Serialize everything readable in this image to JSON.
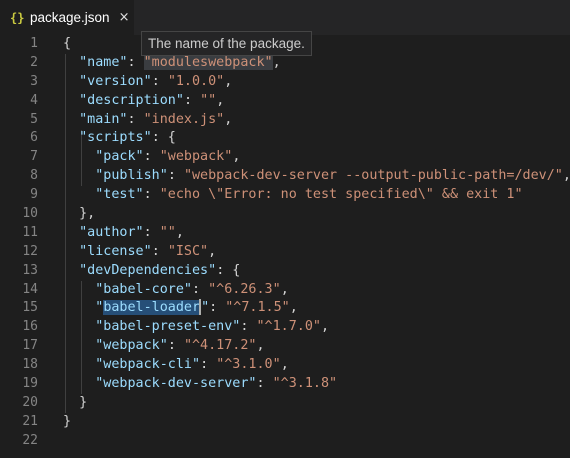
{
  "tab": {
    "icon_text": "{}",
    "title": "package.json",
    "close_glyph": "×"
  },
  "tooltip": {
    "text": "The name of the package."
  },
  "line_numbers": [
    "1",
    "2",
    "3",
    "4",
    "5",
    "6",
    "7",
    "8",
    "9",
    "10",
    "11",
    "12",
    "13",
    "14",
    "15",
    "16",
    "17",
    "18",
    "19",
    "20",
    "21",
    "22"
  ],
  "code": {
    "open_brace": "{",
    "name_key": "\"name\"",
    "name_val": "\"moduleswebpack\"",
    "version_key": "\"version\"",
    "version_val": "\"1.0.0\"",
    "description_key": "\"description\"",
    "description_val": "\"\"",
    "main_key": "\"main\"",
    "main_val": "\"index.js\"",
    "scripts_key": "\"scripts\"",
    "pack_key": "\"pack\"",
    "pack_val": "\"webpack\"",
    "publish_key": "\"publish\"",
    "publish_val": "\"webpack-dev-server --output-public-path=/dev/\"",
    "test_key": "\"test\"",
    "test_val": "\"echo \\\"Error: no test specified\\\" && exit 1\"",
    "author_key": "\"author\"",
    "author_val": "\"\"",
    "license_key": "\"license\"",
    "license_val": "\"ISC\"",
    "devdeps_key": "\"devDependencies\"",
    "babel_core_key": "\"babel-core\"",
    "babel_core_val": "\"^6.26.3\"",
    "babel_loader_q1": "\"",
    "babel_loader_name": "babel-loader",
    "babel_loader_q2": "\"",
    "babel_loader_val": "\"^7.1.5\"",
    "babel_preset_key": "\"babel-preset-env\"",
    "babel_preset_val": "\"^1.7.0\"",
    "webpack_key": "\"webpack\"",
    "webpack_val": "\"^4.17.2\"",
    "webpack_cli_key": "\"webpack-cli\"",
    "webpack_cli_val": "\"^3.1.0\"",
    "wds_key": "\"webpack-dev-server\"",
    "wds_val": "\"^3.1.8\"",
    "close_brace": "}",
    "close_brace_comma": "},",
    "colon": ": ",
    "comma": ",",
    "obj_open": ": {"
  },
  "colors": {
    "background": "#1e1e1e",
    "key": "#9cdcfe",
    "string": "#ce9178",
    "punctuation": "#d4d4d4",
    "line_number": "#858585",
    "selection": "#264f78"
  }
}
